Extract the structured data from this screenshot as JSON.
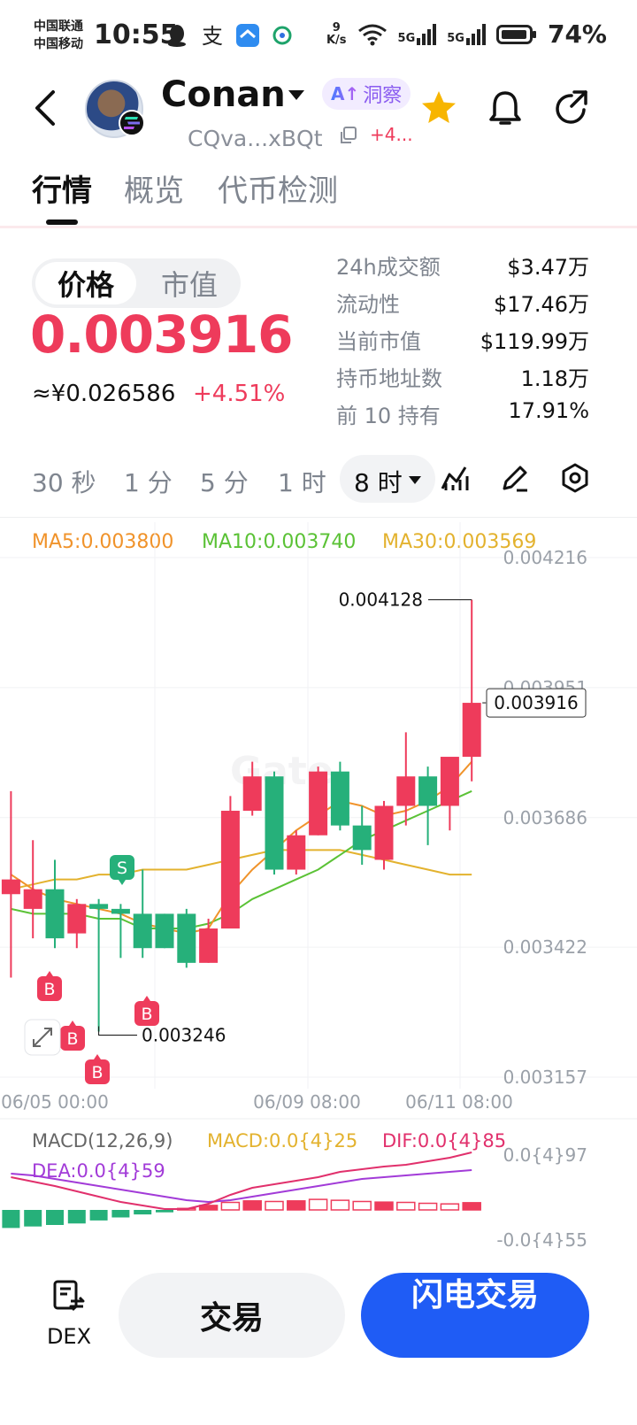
{
  "status_bar": {
    "carrier_1": "中国联通",
    "carrier_2": "中国移动",
    "time": "10:55",
    "net_speed_value": "9",
    "net_speed_unit": "K/s",
    "signal_1": "5G",
    "signal_2": "5G",
    "battery": "74%"
  },
  "header": {
    "token_name": "Conan",
    "insight_prefix": "A↑",
    "insight_label": "洞察",
    "address": "CQva...xBQt",
    "change_small": "+4..."
  },
  "tabs": [
    "行情",
    "概览",
    "代币检测"
  ],
  "price_panel": {
    "segment_active": "价格",
    "segment_inactive": "市值",
    "price": "0.003916",
    "price_cny": "≈¥0.026586",
    "change_pct": "+4.51%"
  },
  "stats": [
    {
      "label": "24h成交额",
      "value": "$3.47万"
    },
    {
      "label": "流动性",
      "value": "$17.46万"
    },
    {
      "label": "当前市值",
      "value": "$119.99万"
    },
    {
      "label": "持币地址数",
      "value": "1.18万"
    },
    {
      "label": "前 10 持有",
      "value": "17.91%"
    }
  ],
  "timeframes": {
    "tf_30s": "30 秒",
    "tf_1m": "1 分",
    "tf_5m": "5 分",
    "tf_1h": "1 时",
    "tf_8h": "8 时"
  },
  "ma": {
    "ma5": "MA5:0.003800",
    "ma10": "MA10:0.003740",
    "ma30": "MA30:0.003569"
  },
  "macd": {
    "title": "MACD(12,26,9)",
    "macd": "MACD:0.0{4}25",
    "dif": "DIF:0.0{4}85",
    "dea": "DEA:0.0{4}59",
    "axis_top": "0.0{4}97",
    "axis_bottom": "-0.0{4}55"
  },
  "colors": {
    "up": "#ee3b5b",
    "down": "#26b07a",
    "ma5": "#f0932b",
    "ma10": "#5bc236",
    "ma30": "#e3b22e",
    "dif": "#e1306c",
    "dea": "#a23bd8",
    "accent": "#1f5cf5"
  },
  "chart_data": {
    "type": "candlestick",
    "y_ticks": [
      "0.004216",
      "0.003951",
      "0.003686",
      "0.003422",
      "0.003157"
    ],
    "ylim": [
      0.003157,
      0.004216
    ],
    "x_ticks": [
      "06/05 00:00",
      "06/09 08:00",
      "06/11 08:00"
    ],
    "high_label": "0.004128",
    "low_label": "0.003246",
    "current_label": "0.003916",
    "candles": [
      {
        "o": 0.00353,
        "h": 0.00374,
        "l": 0.00336,
        "c": 0.00356
      },
      {
        "o": 0.0035,
        "h": 0.00364,
        "l": 0.00344,
        "c": 0.00354
      },
      {
        "o": 0.00354,
        "h": 0.0036,
        "l": 0.00342,
        "c": 0.00344
      },
      {
        "o": 0.00345,
        "h": 0.00352,
        "l": 0.00342,
        "c": 0.00351
      },
      {
        "o": 0.00351,
        "h": 0.00352,
        "l": 0.00325,
        "c": 0.0035
      },
      {
        "o": 0.0035,
        "h": 0.00351,
        "l": 0.0034,
        "c": 0.00349
      },
      {
        "o": 0.00349,
        "h": 0.00358,
        "l": 0.0034,
        "c": 0.00342
      },
      {
        "o": 0.00349,
        "h": 0.00349,
        "l": 0.00342,
        "c": 0.00342
      },
      {
        "o": 0.00349,
        "h": 0.0035,
        "l": 0.00338,
        "c": 0.00339
      },
      {
        "o": 0.00339,
        "h": 0.00348,
        "l": 0.00339,
        "c": 0.00346
      },
      {
        "o": 0.00346,
        "h": 0.00373,
        "l": 0.00346,
        "c": 0.0037
      },
      {
        "o": 0.0037,
        "h": 0.0038,
        "l": 0.00369,
        "c": 0.00377
      },
      {
        "o": 0.00377,
        "h": 0.00378,
        "l": 0.00357,
        "c": 0.00358
      },
      {
        "o": 0.00358,
        "h": 0.00366,
        "l": 0.00357,
        "c": 0.00365
      },
      {
        "o": 0.00365,
        "h": 0.00379,
        "l": 0.00365,
        "c": 0.00378
      },
      {
        "o": 0.00378,
        "h": 0.0038,
        "l": 0.00366,
        "c": 0.00367
      },
      {
        "o": 0.00367,
        "h": 0.00371,
        "l": 0.00359,
        "c": 0.00362
      },
      {
        "o": 0.0036,
        "h": 0.00372,
        "l": 0.00358,
        "c": 0.00371
      },
      {
        "o": 0.00371,
        "h": 0.00386,
        "l": 0.00367,
        "c": 0.00377
      },
      {
        "o": 0.00377,
        "h": 0.00379,
        "l": 0.00363,
        "c": 0.00371
      },
      {
        "o": 0.00371,
        "h": 0.0038,
        "l": 0.00366,
        "c": 0.00381
      },
      {
        "o": 0.00381,
        "h": 0.00413,
        "l": 0.00376,
        "c": 0.00392
      }
    ],
    "ma5": [
      0.00357,
      0.00354,
      0.00352,
      0.00351,
      0.0035,
      0.00349,
      0.00347,
      0.00346,
      0.00345,
      0.00346,
      0.00353,
      0.00358,
      0.00362,
      0.00366,
      0.00369,
      0.00372,
      0.00371,
      0.00369,
      0.0037,
      0.00372,
      0.00375,
      0.0038
    ],
    "ma10": [
      0.0035,
      0.00349,
      0.00349,
      0.00349,
      0.00348,
      0.00348,
      0.00346,
      0.00346,
      0.00346,
      0.00347,
      0.00349,
      0.00352,
      0.00354,
      0.00356,
      0.00358,
      0.00361,
      0.00364,
      0.00366,
      0.00368,
      0.0037,
      0.00372,
      0.00374
    ],
    "ma30": [
      0.00354,
      0.00355,
      0.00356,
      0.00356,
      0.00357,
      0.00357,
      0.00358,
      0.00358,
      0.00358,
      0.00359,
      0.0036,
      0.00361,
      0.00362,
      0.00362,
      0.00362,
      0.00362,
      0.00361,
      0.0036,
      0.00359,
      0.00358,
      0.00357,
      0.00357
    ],
    "markers": [
      {
        "type": "S",
        "index": 4
      },
      {
        "type": "B",
        "index": 1
      },
      {
        "type": "B",
        "index": 2
      },
      {
        "type": "B",
        "index": 3
      },
      {
        "type": "B",
        "index": 5
      }
    ],
    "macd_hist": [
      -0.6,
      -0.55,
      -0.5,
      -0.45,
      -0.35,
      -0.25,
      -0.15,
      -0.08,
      0.05,
      0.15,
      0.25,
      0.3,
      0.28,
      0.3,
      0.35,
      0.32,
      0.28,
      0.26,
      0.25,
      0.22,
      0.2,
      0.24
    ]
  },
  "bottom_bar": {
    "dex_label": "DEX",
    "trade_label": "交易",
    "flash_label": "闪电交易"
  }
}
